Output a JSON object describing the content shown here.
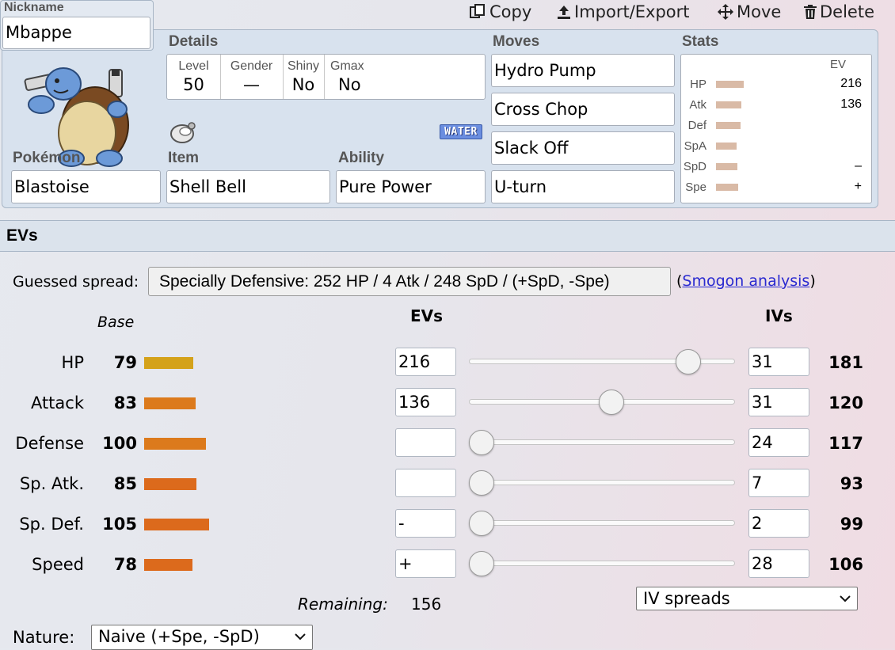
{
  "toolbar": {
    "copy_label": "Copy",
    "import_export_label": "Import/Export",
    "move_label": "Move",
    "delete_label": "Delete"
  },
  "nickname": {
    "label": "Nickname",
    "value": "Mbappe"
  },
  "details": {
    "section_label": "Details",
    "level_label": "Level",
    "level_value": "50",
    "gender_label": "Gender",
    "gender_value": "—",
    "shiny_label": "Shiny",
    "shiny_value": "No",
    "gmax_label": "Gmax",
    "gmax_value": "No",
    "type_badge": "WATER",
    "type_color": "#6b8ee0"
  },
  "pokemon": {
    "label": "Pokémon",
    "value": "Blastoise",
    "sprite_icon": "blastoise-sprite"
  },
  "item": {
    "label": "Item",
    "value": "Shell Bell",
    "icon": "shell-bell-icon"
  },
  "ability": {
    "label": "Ability",
    "value": "Pure Power"
  },
  "moves": {
    "label": "Moves",
    "list": [
      "Hydro Pump",
      "Cross Chop",
      "Slack Off",
      "U-turn"
    ]
  },
  "stats_summary": {
    "label": "Stats",
    "ev_header": "EV",
    "rows": [
      {
        "name": "HP",
        "ev": "216",
        "bar_fraction": 0.79
      },
      {
        "name": "Atk",
        "ev": "136",
        "bar_fraction": 0.72
      },
      {
        "name": "Def",
        "ev": "",
        "bar_fraction": 0.7
      },
      {
        "name": "SpA",
        "ev": "",
        "bar_fraction": 0.58
      },
      {
        "name": "SpD",
        "ev": "–",
        "bar_fraction": 0.62
      },
      {
        "name": "Spe",
        "ev": "+",
        "bar_fraction": 0.63
      }
    ]
  },
  "evs": {
    "title": "EVs",
    "guessed_label": "Guessed spread:",
    "guessed_value": "Specially Defensive: 252 HP / 4 Atk / 248 SpD / (+SpD, -Spe)",
    "smogon_open": "(",
    "smogon_link": "Smogon analysis",
    "smogon_close": ")",
    "base_header": "Base",
    "evs_header": "EVs",
    "ivs_header": "IVs",
    "remaining_label": "Remaining:",
    "remaining_value": "156",
    "iv_spreads_label": "IV spreads",
    "nature_label": "Nature:",
    "nature_value": "Naive (+Spe, -SpD)",
    "rows": [
      {
        "name": "HP",
        "base": "79",
        "base_color": "#d4a21a",
        "ev": "216",
        "slider_fraction": 0.857,
        "iv": "31",
        "final": "181"
      },
      {
        "name": "Attack",
        "base": "83",
        "base_color": "#dc7a1c",
        "ev": "136",
        "slider_fraction": 0.54,
        "iv": "31",
        "final": "120"
      },
      {
        "name": "Defense",
        "base": "100",
        "base_color": "#dc7a1c",
        "ev": "",
        "slider_fraction": 0.0,
        "iv": "24",
        "final": "117"
      },
      {
        "name": "Sp. Atk.",
        "base": "85",
        "base_color": "#dc6a1c",
        "ev": "",
        "slider_fraction": 0.0,
        "iv": "7",
        "final": "93"
      },
      {
        "name": "Sp. Def.",
        "base": "105",
        "base_color": "#dc6a1c",
        "ev": "-",
        "slider_fraction": 0.0,
        "iv": "2",
        "final": "99"
      },
      {
        "name": "Speed",
        "base": "78",
        "base_color": "#dc6a1c",
        "ev": "+",
        "slider_fraction": 0.0,
        "iv": "28",
        "final": "106"
      }
    ]
  }
}
